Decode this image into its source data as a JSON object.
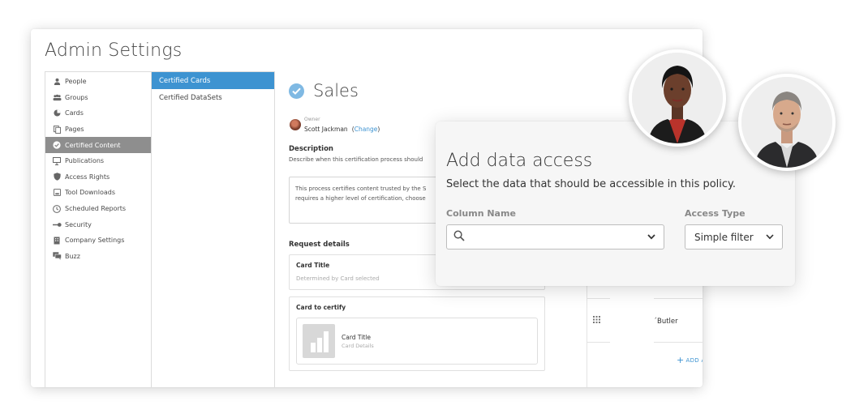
{
  "app": {
    "title": "Admin Settings"
  },
  "nav": {
    "items": [
      {
        "label": "People",
        "icon": "person-icon"
      },
      {
        "label": "Groups",
        "icon": "groups-icon"
      },
      {
        "label": "Cards",
        "icon": "pie-chart-icon"
      },
      {
        "label": "Pages",
        "icon": "pages-icon"
      },
      {
        "label": "Certified Content",
        "icon": "check-circle-icon",
        "active": true
      },
      {
        "label": "Publications",
        "icon": "publications-icon"
      },
      {
        "label": "Access Rights",
        "icon": "shield-icon"
      },
      {
        "label": "Tool Downloads",
        "icon": "download-icon"
      },
      {
        "label": "Scheduled Reports",
        "icon": "clock-icon"
      },
      {
        "label": "Security",
        "icon": "key-icon"
      },
      {
        "label": "Company Settings",
        "icon": "building-icon"
      },
      {
        "label": "Buzz",
        "icon": "chat-icon"
      }
    ]
  },
  "subnav": {
    "items": [
      {
        "label": "Certified Cards",
        "active": true
      },
      {
        "label": "Certified DataSets"
      }
    ]
  },
  "main": {
    "title": "Sales",
    "owner_label": "Owner",
    "owner_name": "Scott Jackman",
    "change_paren_open": "(",
    "change_link": "Change",
    "change_paren_close": ")",
    "description_title": "Description",
    "description_hint": "Describe when this certification process should",
    "description_text_line1": "This process certifies content trusted by the S",
    "description_text_line2": "requires a higher level of certification, choose",
    "request_title": "Request details",
    "card_title_label": "Card Title",
    "card_title_value": "Determined by Card selected",
    "card_to_certify_label": "Card to certify",
    "card_preview_title": "Card Title",
    "card_preview_details": "Card Details"
  },
  "right_panel": {
    "approver_name": "Butler",
    "approver_prefix": "́",
    "add_approver": "ADD APPROVE"
  },
  "modal": {
    "title": "Add data access",
    "subtitle": "Select the data that should be accessible in this policy.",
    "column_name_label": "Column Name",
    "column_name_value": "",
    "access_type_label": "Access Type",
    "access_type_value": "Simple filter"
  },
  "colors": {
    "accent": "#3d93d1",
    "nav_active": "#8e8e8e",
    "check": "#7fb9e3"
  }
}
